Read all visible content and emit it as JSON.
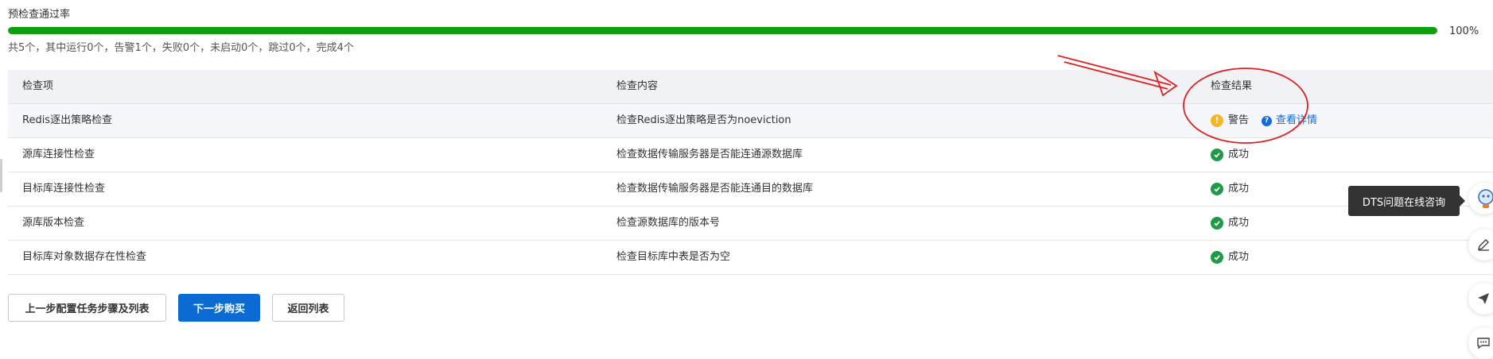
{
  "precheck": {
    "title": "预检查通过率",
    "progress": 1.0,
    "progress_label": "100%",
    "summary": "共5个，其中运行0个，告警1个，失败0个，未启动0个，跳过0个，完成4个"
  },
  "table": {
    "headers": [
      "检查项",
      "检查内容",
      "检查结果"
    ],
    "rows": [
      {
        "item": "Redis逐出策略检查",
        "content": "检查Redis逐出策略是否为noeviction",
        "result": "警告",
        "status": "warning",
        "link": "查看详情"
      },
      {
        "item": "源库连接性检查",
        "content": "检查数据传输服务器是否能连通源数据库",
        "result": "成功",
        "status": "success"
      },
      {
        "item": "目标库连接性检查",
        "content": "检查数据传输服务器是否能连通目的数据库",
        "result": "成功",
        "status": "success"
      },
      {
        "item": "源库版本检查",
        "content": "检查源数据库的版本号",
        "result": "成功",
        "status": "success"
      },
      {
        "item": "目标库对象数据存在性检查",
        "content": "检查目标库中表是否为空",
        "result": "成功",
        "status": "success"
      }
    ]
  },
  "buttons": {
    "prev": "上一步配置任务步骤及列表",
    "next": "下一步购买",
    "back": "返回列表"
  },
  "tooltip": "DTS问题在线咨询",
  "colors": {
    "progress": "#0e9f0e",
    "primary": "#0b6bd2",
    "success": "#1f9b48",
    "warning": "#f5b62a",
    "annotation": "#e02020"
  },
  "icons": {
    "warning": "warning-icon",
    "success": "check-circle-icon",
    "help": "help-icon",
    "side": [
      "robot-assistant-icon",
      "edit-icon",
      "feedback-plane-icon",
      "chat-icon"
    ]
  }
}
